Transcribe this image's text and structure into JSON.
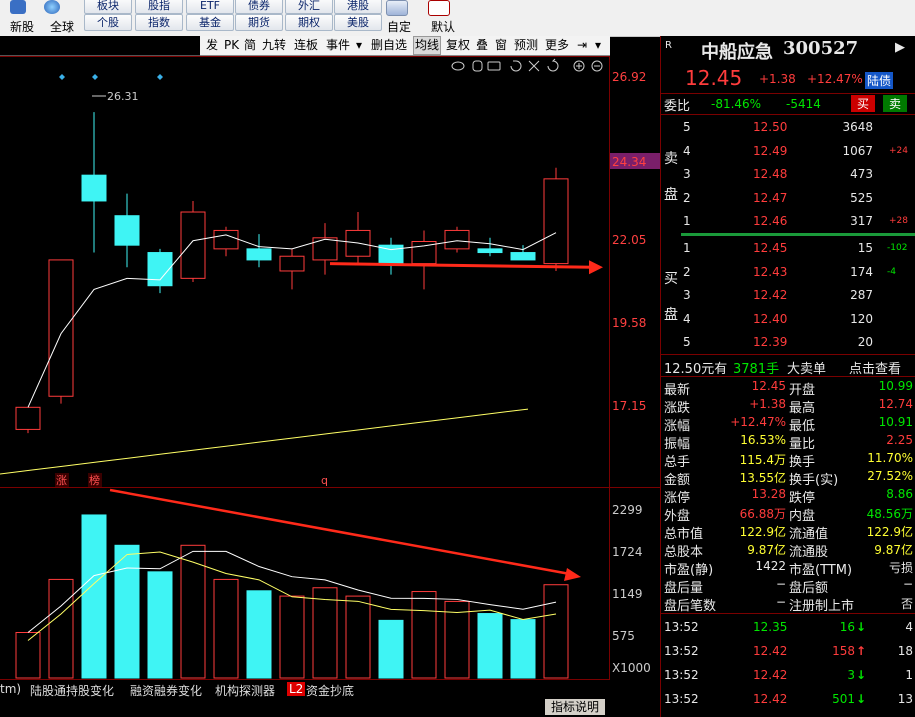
{
  "toolbar": {
    "buttons_row1": [
      "板块",
      "股指",
      "ETF",
      "债券",
      "外汇",
      "港股"
    ],
    "buttons_row2": [
      "个股",
      "指数",
      "基金",
      "期货",
      "期权",
      "美股"
    ],
    "left_labels": [
      "新股",
      "全球"
    ],
    "right_labels": [
      "自定",
      "默认"
    ]
  },
  "chart_toolbar": {
    "items": [
      "发",
      "PK",
      "简",
      "九转",
      "连板",
      "事件",
      "▾",
      "删自选",
      "均线",
      "复权",
      "叠",
      "窗",
      "预测",
      "更多",
      "⇥",
      "▾"
    ]
  },
  "price_chart": {
    "price_axis": [
      "26.92",
      "24.34",
      "22.05",
      "19.58",
      "17.15"
    ],
    "highlight_price": "24.34",
    "high_label": "26.31",
    "markers": [
      "涨",
      "榜",
      "q"
    ],
    "colors": {
      "up": "#ff3c3c",
      "down": "#3ff4f4",
      "ma5": "#ffffff",
      "ma10": "#ffff66",
      "arrow": "#ff2a1a"
    }
  },
  "volume_chart": {
    "axis": [
      "2299",
      "1724",
      "1149",
      "575",
      "X1000"
    ]
  },
  "chart_data": {
    "type": "candlestick",
    "x": [
      1,
      2,
      3,
      4,
      5,
      6,
      7,
      8,
      9,
      10,
      11,
      12,
      13,
      14,
      15,
      16,
      17
    ],
    "ohlc": [
      [
        17.7,
        18.3,
        17.6,
        18.3
      ],
      [
        18.6,
        22.3,
        18.4,
        22.3
      ],
      [
        24.6,
        26.31,
        22.5,
        23.9
      ],
      [
        23.5,
        24.1,
        22.1,
        22.7
      ],
      [
        22.5,
        22.6,
        21.4,
        21.6
      ],
      [
        21.8,
        23.9,
        21.7,
        23.6
      ],
      [
        22.6,
        23.2,
        22.4,
        23.1
      ],
      [
        22.6,
        23.0,
        22.1,
        22.3
      ],
      [
        22.0,
        22.6,
        21.5,
        22.4
      ],
      [
        22.3,
        23.3,
        21.9,
        22.9
      ],
      [
        22.4,
        23.6,
        22.2,
        23.1
      ],
      [
        22.7,
        22.9,
        21.9,
        22.2
      ],
      [
        22.2,
        23.1,
        21.5,
        22.8
      ],
      [
        22.6,
        23.2,
        22.5,
        23.1
      ],
      [
        22.6,
        22.9,
        22.4,
        22.5
      ],
      [
        22.5,
        22.7,
        22.4,
        22.3
      ],
      [
        22.2,
        24.8,
        22.0,
        24.5
      ]
    ],
    "volume": [
      600,
      1300,
      2150,
      1750,
      1400,
      1750,
      1300,
      1150,
      1080,
      1190,
      1080,
      760,
      1140,
      1010,
      850,
      770,
      1230
    ],
    "ylim": [
      16.3,
      27.4
    ],
    "vol_ylim": [
      0,
      2400
    ]
  },
  "bottom_tabs": [
    "tm)",
    "陆股通持股变化",
    "融资融券变化",
    "机构探测器",
    "L2",
    "资金抄底"
  ],
  "indicator_btn": "指标说明",
  "stock": {
    "badge": "R",
    "name": "中船应急",
    "code": "300527",
    "price": "12.45",
    "change": "+1.38",
    "pct": "+12.47%",
    "tag": "陆债",
    "weibi_label": "委比",
    "weibi": "-81.46%",
    "weicha": "-5414",
    "sell_btn": "买",
    "buy_btn": "卖"
  },
  "order_book": {
    "sell_side_label": [
      "卖",
      "盘"
    ],
    "buy_side_label": [
      "买",
      "盘"
    ],
    "asks": [
      {
        "lvl": "5",
        "price": "12.50",
        "vol": "3648",
        "chg": ""
      },
      {
        "lvl": "4",
        "price": "12.49",
        "vol": "1067",
        "chg": "+24"
      },
      {
        "lvl": "3",
        "price": "12.48",
        "vol": "473",
        "chg": ""
      },
      {
        "lvl": "2",
        "price": "12.47",
        "vol": "525",
        "chg": ""
      },
      {
        "lvl": "1",
        "price": "12.46",
        "vol": "317",
        "chg": "+28"
      }
    ],
    "bids": [
      {
        "lvl": "1",
        "price": "12.45",
        "vol": "15",
        "chg": "-102"
      },
      {
        "lvl": "2",
        "price": "12.43",
        "vol": "174",
        "chg": "-4"
      },
      {
        "lvl": "3",
        "price": "12.42",
        "vol": "287",
        "chg": ""
      },
      {
        "lvl": "4",
        "price": "12.40",
        "vol": "120",
        "chg": ""
      },
      {
        "lvl": "5",
        "price": "12.39",
        "vol": "20",
        "chg": ""
      }
    ]
  },
  "big_order": {
    "price": "12.50元有",
    "amount": "3781手",
    "label": "大卖单",
    "link": "点击查看"
  },
  "stats": [
    {
      "l1": "最新",
      "v1": "12.45",
      "c1": "red",
      "l2": "开盘",
      "v2": "10.99",
      "c2": "green"
    },
    {
      "l1": "涨跌",
      "v1": "+1.38",
      "c1": "red",
      "l2": "最高",
      "v2": "12.74",
      "c2": "red"
    },
    {
      "l1": "涨幅",
      "v1": "+12.47%",
      "c1": "red",
      "l2": "最低",
      "v2": "10.91",
      "c2": "green"
    },
    {
      "l1": "振幅",
      "v1": "16.53%",
      "c1": "yellow",
      "l2": "量比",
      "v2": "2.25",
      "c2": "red"
    },
    {
      "l1": "总手",
      "v1": "115.4万",
      "c1": "yellow",
      "l2": "换手",
      "v2": "11.70%",
      "c2": "yellow"
    },
    {
      "l1": "金额",
      "v1": "13.55亿",
      "c1": "yellow",
      "l2": "换手(实)",
      "v2": "27.52%",
      "c2": "yellow"
    },
    {
      "l1": "涨停",
      "v1": "13.28",
      "c1": "red",
      "l2": "跌停",
      "v2": "8.86",
      "c2": "green"
    },
    {
      "l1": "外盘",
      "v1": "66.88万",
      "c1": "red",
      "l2": "内盘",
      "v2": "48.56万",
      "c2": "green"
    },
    {
      "l1": "总市值",
      "v1": "122.9亿",
      "c1": "yellow",
      "l2": "流通值",
      "v2": "122.9亿",
      "c2": "yellow"
    },
    {
      "l1": "总股本",
      "v1": "9.87亿",
      "c1": "yellow",
      "l2": "流通股",
      "v2": "9.87亿",
      "c2": "yellow"
    },
    {
      "l1": "市盈(静)",
      "v1": "1422",
      "c1": "white",
      "l2": "市盈(TTM)",
      "v2": "亏损",
      "c2": "white"
    },
    {
      "l1": "盘后量",
      "v1": "−",
      "c1": "white",
      "l2": "盘后额",
      "v2": "−",
      "c2": "white"
    },
    {
      "l1": "盘后笔数",
      "v1": "−",
      "c1": "white",
      "l2": "注册制上市",
      "v2": "否",
      "c2": "white"
    }
  ],
  "ticks": [
    {
      "time": "13:52",
      "price": "12.35",
      "vol": "16",
      "dir": "down",
      "n": "4"
    },
    {
      "time": "13:52",
      "price": "12.42",
      "vol": "158",
      "dir": "up",
      "n": "18"
    },
    {
      "time": "13:52",
      "price": "12.42",
      "vol": "3",
      "dir": "down",
      "n": "1"
    },
    {
      "time": "13:52",
      "price": "12.42",
      "vol": "501",
      "dir": "down",
      "n": "13"
    }
  ]
}
